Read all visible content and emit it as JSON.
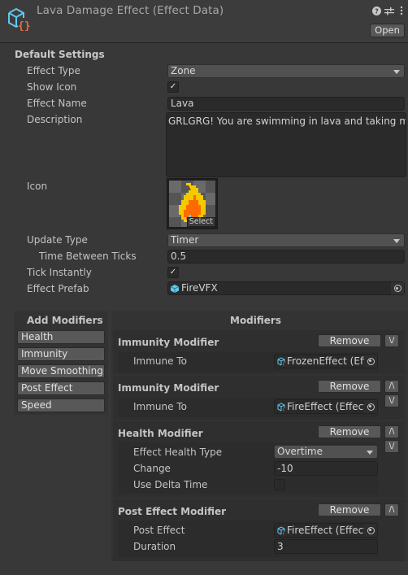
{
  "header": {
    "title": "Lava Damage Effect (Effect Data)",
    "icons": [
      "scriptable-object-icon",
      "help-icon",
      "settings-sliders-icon",
      "more-menu-icon"
    ],
    "open_label": "Open"
  },
  "default_settings": {
    "title": "Default Settings",
    "effect_type": {
      "label": "Effect Type",
      "value": "Zone"
    },
    "show_icon": {
      "label": "Show Icon",
      "checked": true,
      "glyph": "✓"
    },
    "effect_name": {
      "label": "Effect Name",
      "value": "Lava"
    },
    "description": {
      "label": "Description",
      "value": "GRLGRG! You are swimming in lava and taking majo"
    },
    "icon": {
      "label": "Icon",
      "select_label": "Select",
      "image": "fire-sprite"
    },
    "update_type": {
      "label": "Update Type",
      "value": "Timer"
    },
    "time_between_ticks": {
      "label": "Time Between Ticks",
      "value": "0.5"
    },
    "tick_instantly": {
      "label": "Tick Instantly",
      "checked": true,
      "glyph": "✓"
    },
    "effect_prefab": {
      "label": "Effect Prefab",
      "value": "FireVFX"
    }
  },
  "add_modifiers": {
    "title": "Add Modifiers",
    "buttons": [
      "Health",
      "Immunity",
      "Move Smoothing",
      "Post Effect",
      "Speed"
    ]
  },
  "modifiers": {
    "title": "Modifiers",
    "remove_label": "Remove",
    "up_label": "/\\",
    "down_label": "\\/",
    "items": [
      {
        "title": "Immunity Modifier",
        "fields": [
          {
            "label": "Immune To",
            "value": "FrozenEffect (Effect Data)"
          }
        ]
      },
      {
        "title": "Immunity Modifier",
        "fields": [
          {
            "label": "Immune To",
            "value": "FireEffect (Effect Data)"
          }
        ]
      },
      {
        "title": "Health Modifier",
        "fields": [
          {
            "label": "Effect Health Type",
            "value": "Overtime"
          },
          {
            "label": "Change",
            "value": "-10"
          },
          {
            "label": "Use Delta Time",
            "checked": false
          }
        ]
      },
      {
        "title": "Post Effect Modifier",
        "fields": [
          {
            "label": "Post Effect",
            "value": "FireEffect (Effect Data)"
          },
          {
            "label": "Duration",
            "value": "3"
          }
        ]
      }
    ]
  },
  "colors": {
    "background": "#383838",
    "header": "#3c3c3c",
    "field": "#2a2a2a",
    "button": "#585858",
    "cube_blue": "#5ec8f0",
    "braces_orange": "#f26b3a"
  }
}
